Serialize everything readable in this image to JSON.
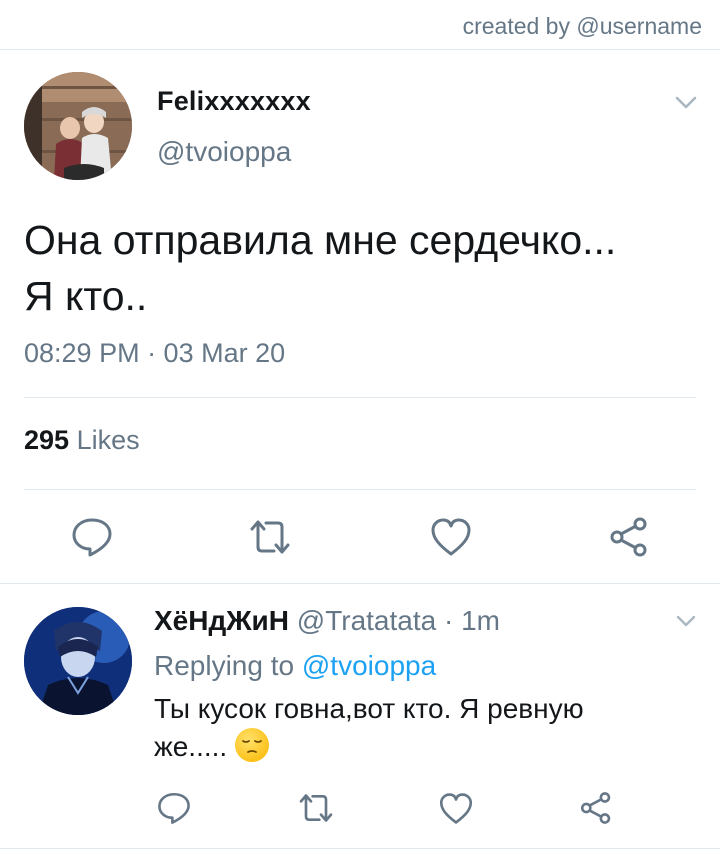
{
  "credit": "created by @username",
  "tweet": {
    "display_name": "Felixxxxxxx",
    "handle": "@tvoioppa",
    "text_line1": "Она отправила мне сердечко...",
    "text_line2": "Я кто..",
    "timestamp": "08:29 PM · 03 Mar 20",
    "likes_count": "295",
    "likes_label": "Likes",
    "actions": [
      "reply-icon",
      "retweet-icon",
      "like-icon",
      "share-icon"
    ]
  },
  "reply": {
    "display_name": "ХёНдЖиН",
    "handle": "@Tratatata",
    "time": "· 1m",
    "replying_label": "Replying to",
    "replying_to": "@tvoioppa",
    "text_line1": "Ты кусок говна,вот кто. Я ревную",
    "text_line2": "же.....",
    "emoji": "pensive-face",
    "actions": [
      "reply-icon",
      "retweet-icon",
      "like-icon",
      "share-icon"
    ]
  },
  "colors": {
    "text": "#14171a",
    "secondary": "#657786",
    "link": "#1da1f2",
    "divider": "#e1e8ed"
  }
}
